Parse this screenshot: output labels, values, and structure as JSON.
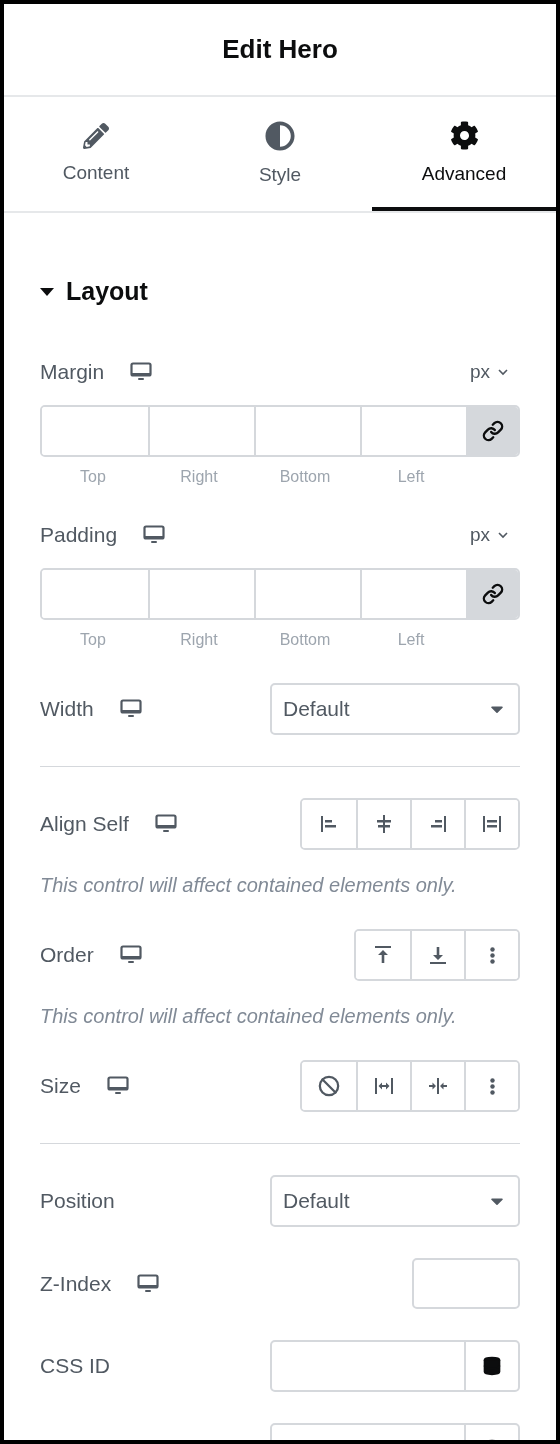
{
  "header": {
    "title": "Edit Hero"
  },
  "tabs": [
    {
      "label": "Content",
      "kind": "pencil",
      "selected": false
    },
    {
      "label": "Style",
      "kind": "contrast",
      "selected": false
    },
    {
      "label": "Advanced",
      "kind": "gear",
      "selected": true
    }
  ],
  "section": {
    "title": "Layout",
    "expanded": true
  },
  "controls": [
    {
      "kind": "dimensions",
      "label": "Margin",
      "responsive": true,
      "unit": "px",
      "linked": true,
      "sides": [
        "Top",
        "Right",
        "Bottom",
        "Left"
      ]
    },
    {
      "kind": "dimensions",
      "label": "Padding",
      "responsive": true,
      "unit": "px",
      "linked": true,
      "sides": [
        "Top",
        "Right",
        "Bottom",
        "Left"
      ]
    },
    {
      "kind": "select",
      "label": "Width",
      "responsive": true,
      "value": "Default"
    },
    {
      "kind": "divider"
    },
    {
      "kind": "choices",
      "label": "Align Self",
      "responsive": true,
      "options": [
        {
          "kind": "align-start"
        },
        {
          "kind": "align-center"
        },
        {
          "kind": "align-end"
        },
        {
          "kind": "stretch"
        }
      ],
      "note": "This control will affect contained elements only."
    },
    {
      "kind": "choices",
      "label": "Order",
      "responsive": true,
      "options": [
        {
          "kind": "first"
        },
        {
          "kind": "last"
        },
        {
          "kind": "more"
        }
      ],
      "note": "This control will affect contained elements only."
    },
    {
      "kind": "choices",
      "label": "Size",
      "responsive": true,
      "options": [
        {
          "kind": "none"
        },
        {
          "kind": "grow"
        },
        {
          "kind": "shrink"
        },
        {
          "kind": "more"
        }
      ]
    },
    {
      "kind": "divider"
    },
    {
      "kind": "select",
      "label": "Position",
      "responsive": false,
      "value": "Default"
    },
    {
      "kind": "number",
      "label": "Z-Index",
      "responsive": true
    },
    {
      "kind": "input-dynamic",
      "label": "CSS ID",
      "responsive": false
    },
    {
      "kind": "input-dynamic"
    }
  ]
}
